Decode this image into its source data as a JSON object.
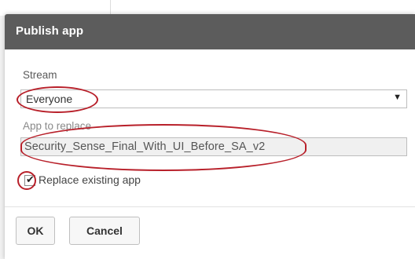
{
  "dialog": {
    "title": "Publish app"
  },
  "stream": {
    "label": "Stream",
    "selected": "Everyone",
    "arrow_glyph": "▼"
  },
  "app_to_replace": {
    "label": "App to replace",
    "value": "Security_Sense_Final_With_UI_Before_SA_v2"
  },
  "replace_existing": {
    "label": "Replace existing app",
    "checked": true,
    "check_glyph": "✔"
  },
  "buttons": {
    "ok_label": "OK",
    "cancel_label": "Cancel"
  },
  "colors": {
    "header_bg": "#5c5c5c",
    "annotation": "#b8202a"
  }
}
